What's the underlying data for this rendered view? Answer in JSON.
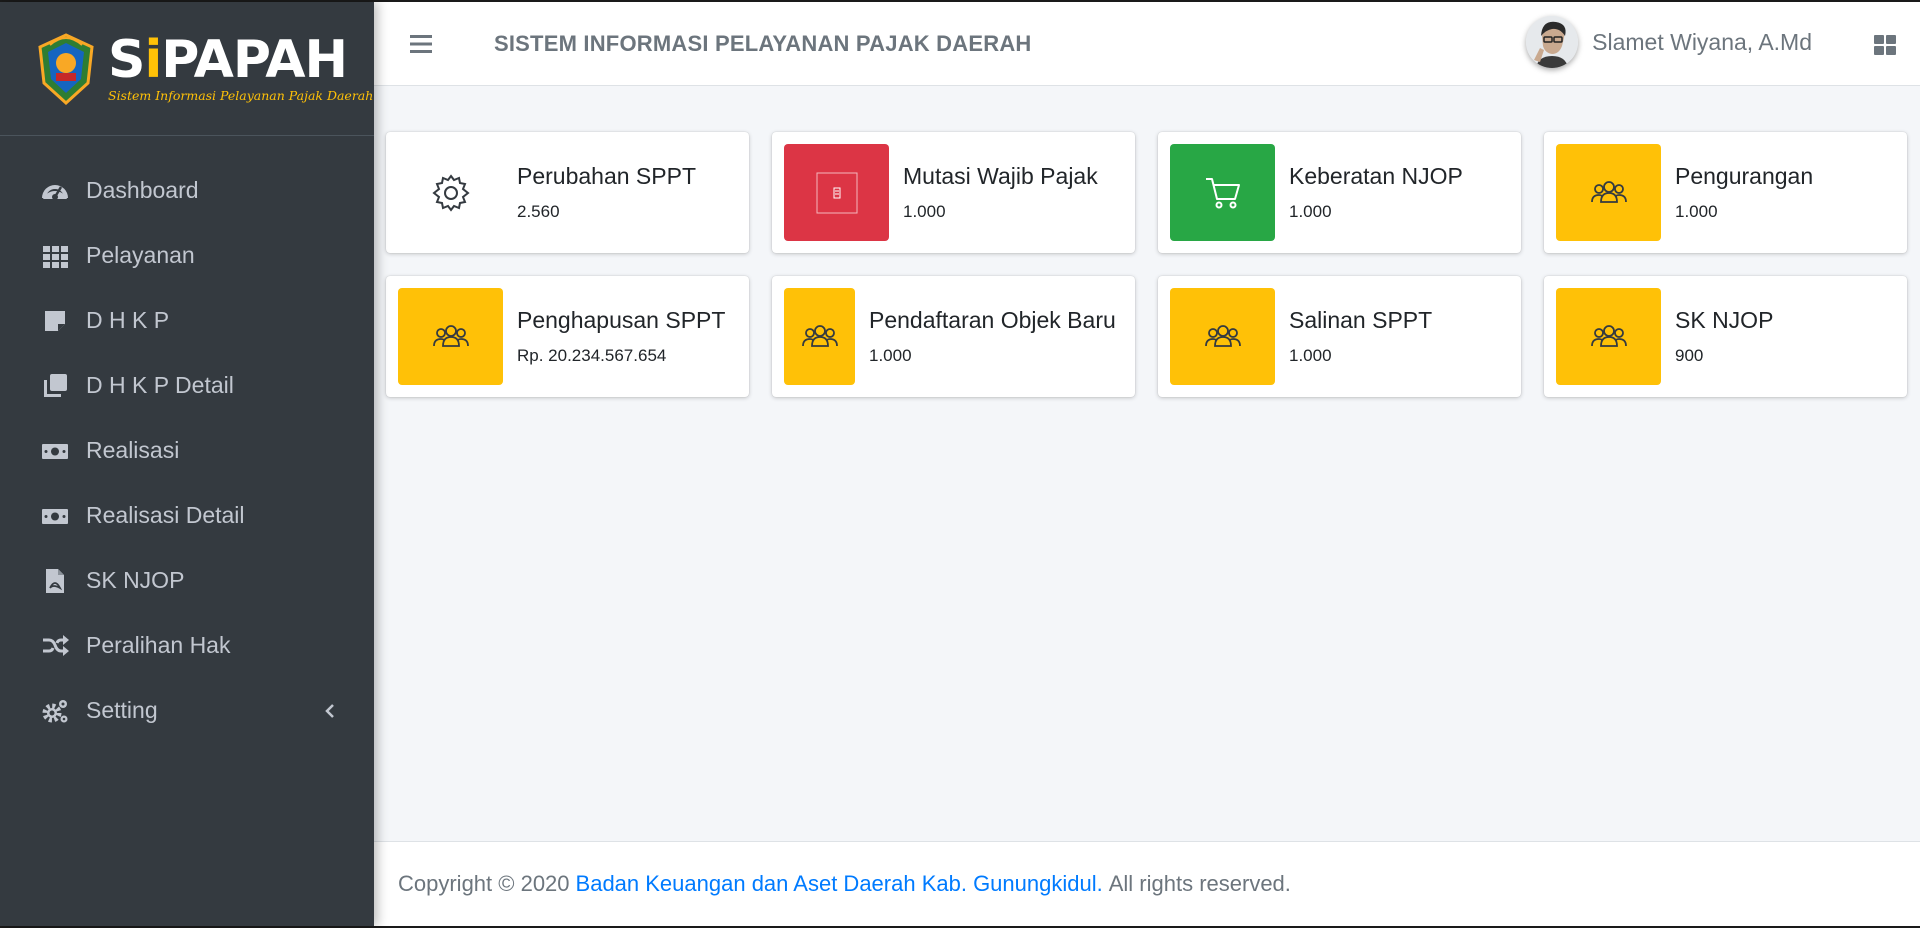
{
  "brand": {
    "title_pre": "S",
    "title_dot": "i",
    "title_post": "PAPAH",
    "subtitle": "Sistem Informasi Pelayanan Pajak Daerah"
  },
  "topbar": {
    "title": "SISTEM INFORMASI PELAYANAN PAJAK DAERAH",
    "user_name": "Slamet Wiyana, A.Md"
  },
  "sidebar": {
    "items": [
      {
        "label": "Dashboard",
        "icon": "tachometer-icon"
      },
      {
        "label": "Pelayanan",
        "icon": "grid-icon"
      },
      {
        "label": "D H K P",
        "icon": "sticky-note-icon"
      },
      {
        "label": "D H K P Detail",
        "icon": "clone-icon"
      },
      {
        "label": "Realisasi",
        "icon": "money-bill-icon"
      },
      {
        "label": "Realisasi Detail",
        "icon": "money-bill-icon"
      },
      {
        "label": "SK NJOP",
        "icon": "file-pdf-icon"
      },
      {
        "label": "Peralihan Hak",
        "icon": "random-icon"
      },
      {
        "label": "Setting",
        "icon": "cogs-icon"
      }
    ]
  },
  "cards": [
    {
      "title": "Perubahan SPPT",
      "value": "2.560",
      "icon": "gear-icon",
      "color": "#ffffff"
    },
    {
      "title": "Mutasi Wajib Pajak",
      "value": "1.000",
      "icon": "broken-image-icon",
      "color": "#dc3545"
    },
    {
      "title": "Keberatan NJOP",
      "value": "1.000",
      "icon": "cart-icon",
      "color": "#28a745"
    },
    {
      "title": "Pengurangan",
      "value": "1.000",
      "icon": "users-icon",
      "color": "#ffc107"
    },
    {
      "title": "Penghapusan SPPT",
      "value": "Rp. 20.234.567.654",
      "icon": "users-icon",
      "color": "#ffc107"
    },
    {
      "title": "Pendaftaran Objek Baru",
      "value": "1.000",
      "icon": "users-icon",
      "color": "#ffc107"
    },
    {
      "title": "Salinan SPPT",
      "value": "1.000",
      "icon": "users-icon",
      "color": "#ffc107"
    },
    {
      "title": "SK NJOP",
      "value": "900",
      "icon": "users-icon",
      "color": "#ffc107"
    }
  ],
  "footer": {
    "prefix": "Copyright © 2020",
    "link": "Badan Keuangan dan Aset Daerah Kab. Gunungkidul.",
    "suffix": "All rights reserved."
  },
  "colors": {
    "sidebar_bg": "#343a40",
    "content_bg": "#f4f6f9",
    "danger": "#dc3545",
    "success": "#28a745",
    "warning": "#ffc107",
    "link": "#007bff"
  }
}
